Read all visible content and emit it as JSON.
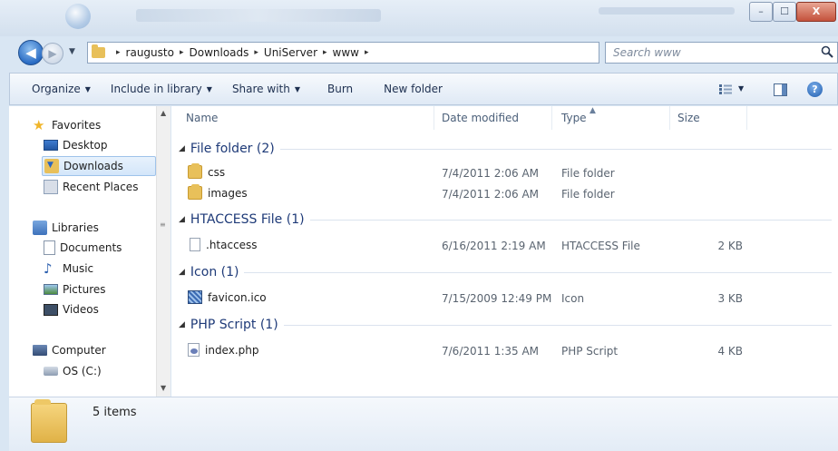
{
  "window": {
    "minimize_label": "–",
    "maximize_label": "☐",
    "close_label": "X"
  },
  "address": {
    "breadcrumbs": [
      "raugusto",
      "Downloads",
      "UniServer",
      "www"
    ],
    "separator": "▸"
  },
  "search": {
    "placeholder": "Search www"
  },
  "toolbar": {
    "organize": "Organize",
    "include_in_library": "Include in library",
    "share_with": "Share with",
    "burn": "Burn",
    "new_folder": "New folder",
    "help": "?"
  },
  "nav": {
    "favorites": "Favorites",
    "desktop": "Desktop",
    "downloads": "Downloads",
    "recent_places": "Recent Places",
    "libraries": "Libraries",
    "documents": "Documents",
    "music": "Music",
    "pictures": "Pictures",
    "videos": "Videos",
    "computer": "Computer",
    "os_drive": "OS (C:)"
  },
  "columns": {
    "name": "Name",
    "date_modified": "Date modified",
    "type": "Type",
    "size": "Size"
  },
  "groups": [
    {
      "label": "File folder (2)",
      "files": [
        {
          "name": "css",
          "date": "7/4/2011 2:06 AM",
          "type": "File folder",
          "size": "",
          "icon": "folder-icon"
        },
        {
          "name": "images",
          "date": "7/4/2011 2:06 AM",
          "type": "File folder",
          "size": "",
          "icon": "folder-icon"
        }
      ]
    },
    {
      "label": "HTACCESS File (1)",
      "files": [
        {
          "name": ".htaccess",
          "date": "6/16/2011 2:19 AM",
          "type": "HTACCESS File",
          "size": "2 KB",
          "icon": "blank-file-icon"
        }
      ]
    },
    {
      "label": "Icon (1)",
      "files": [
        {
          "name": "favicon.ico",
          "date": "7/15/2009 12:49 PM",
          "type": "Icon",
          "size": "3 KB",
          "icon": "image-file-icon"
        }
      ]
    },
    {
      "label": "PHP Script (1)",
      "files": [
        {
          "name": "index.php",
          "date": "7/6/2011 1:35 AM",
          "type": "PHP Script",
          "size": "4 KB",
          "icon": "php-file-icon"
        }
      ]
    }
  ],
  "status": {
    "items_count": "5 items"
  }
}
